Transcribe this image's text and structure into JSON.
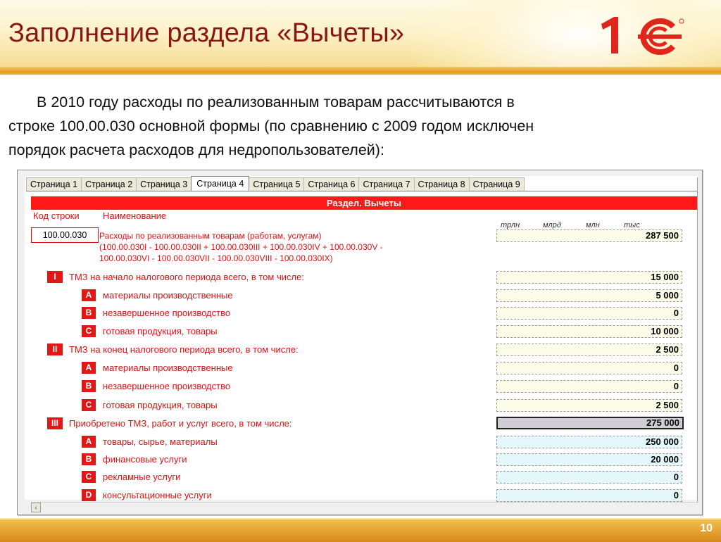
{
  "slide": {
    "title": "Заполнение раздела «Вычеты»",
    "logo_text": "1С",
    "page_number": "10",
    "intro_line1": "В 2010 году расходы по реализованным товарам рассчитываются в",
    "intro_line2": "строке 100.00.030 основной формы (по сравнению с 2009 годом исключен",
    "intro_line3": "порядок расчета расходов для недропользователей):"
  },
  "form": {
    "tabs": [
      "Страница 1",
      "Страница 2",
      "Страница 3",
      "Страница 4",
      "Страница 5",
      "Страница 6",
      "Страница 7",
      "Страница 8",
      "Страница 9"
    ],
    "active_tab": "Страница 4",
    "banner": "Раздел. Вычеты",
    "col_code": "Код строки",
    "col_name": "Наименование",
    "units": [
      "трлн",
      "млрд",
      "млн",
      "тыс"
    ],
    "main_row": {
      "code": "100.00.030",
      "desc_line1": "Расходы по реализованным товарам (работам, услугам)",
      "desc_line2": "(100.00.030I - 100.00.030II + 100.00.030III + 100.00.030IV + 100.00.030V -",
      "desc_line3": "100.00.030VI - 100.00.030VII - 100.00.030VIII - 100.00.030IX)",
      "value": "287 500"
    },
    "sections": [
      {
        "badge": "I",
        "label": "ТМЗ на начало налогового периода всего, в том числе:",
        "value": "15 000",
        "items": [
          {
            "badge": "A",
            "label": "материалы производственные",
            "value": "5 000"
          },
          {
            "badge": "B",
            "label": "незавершенное производство",
            "value": "0"
          },
          {
            "badge": "C",
            "label": "готовая продукция, товары",
            "value": "10 000"
          }
        ]
      },
      {
        "badge": "II",
        "label": "ТМЗ на конец налогового периода всего, в том числе:",
        "value": "2 500",
        "items": [
          {
            "badge": "A",
            "label": "материалы производственные",
            "value": "0"
          },
          {
            "badge": "B",
            "label": "незавершенное производство",
            "value": "0"
          },
          {
            "badge": "C",
            "label": "готовая продукция, товары",
            "value": "2 500"
          }
        ]
      },
      {
        "badge": "III",
        "label": "Приобретено ТМЗ, работ и услуг всего, в том числе:",
        "value": "275 000",
        "items": [
          {
            "badge": "A",
            "label": "товары, сырье, материалы",
            "value": "250 000"
          },
          {
            "badge": "B",
            "label": "финансовые услуги",
            "value": "20 000"
          },
          {
            "badge": "C",
            "label": "рекламные услуги",
            "value": "0"
          },
          {
            "badge": "D",
            "label": "консультационные услуги",
            "value": "0"
          }
        ]
      }
    ],
    "scroll_left_icon": "chevron-left-icon"
  }
}
